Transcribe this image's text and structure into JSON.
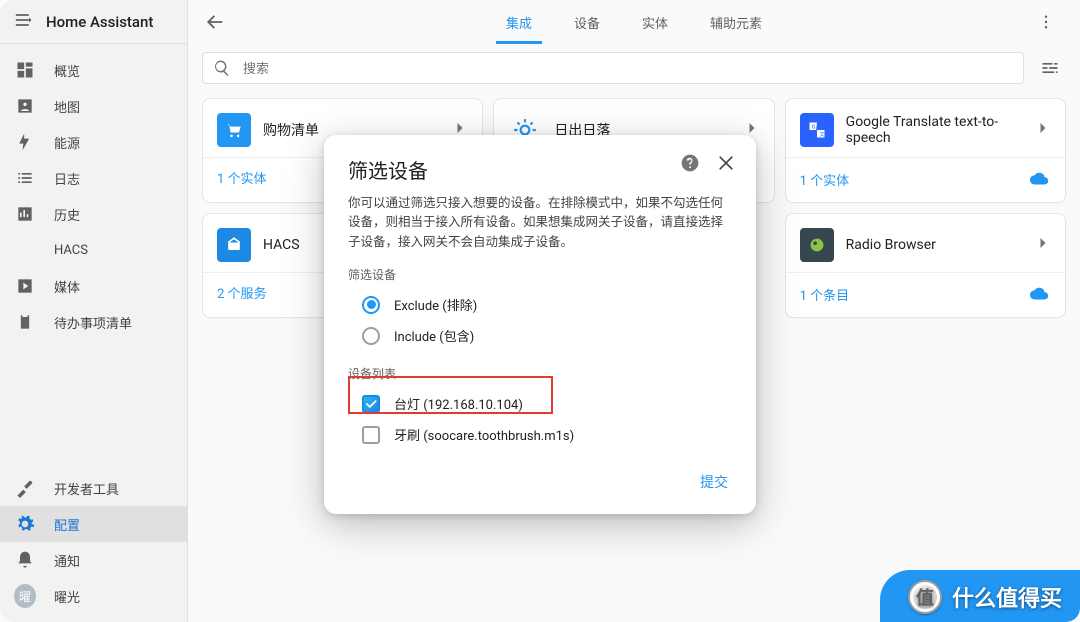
{
  "app": {
    "title": "Home Assistant"
  },
  "sidebar": {
    "items": [
      {
        "label": "概览"
      },
      {
        "label": "地图"
      },
      {
        "label": "能源"
      },
      {
        "label": "日志"
      },
      {
        "label": "历史"
      },
      {
        "label": "HACS"
      },
      {
        "label": "媒体"
      },
      {
        "label": "待办事项清单"
      }
    ],
    "bottom": {
      "dev": "开发者工具",
      "config": "配置",
      "notify": "通知",
      "user": {
        "initial": "曜",
        "name": "曜光"
      }
    }
  },
  "tabs": {
    "t0": "集成",
    "t1": "设备",
    "t2": "实体",
    "t3": "辅助元素"
  },
  "search": {
    "placeholder": "搜索"
  },
  "cards": [
    {
      "title": "购物清单",
      "footer": "1 个实体",
      "cloud": false,
      "icon_bg": "#2196f3"
    },
    {
      "title": "日出日落",
      "footer": "",
      "cloud": false,
      "icon_bg": "#2196f3"
    },
    {
      "title": "Google Translate text-to-speech",
      "footer": "1 个实体",
      "cloud": true,
      "icon_bg": "#2962ff"
    },
    {
      "title": "HACS",
      "footer": "2 个服务",
      "cloud": false,
      "icon_bg": "#1e88e5"
    },
    {
      "title": "",
      "footer": "",
      "cloud": false,
      "icon_bg": ""
    },
    {
      "title": "Radio Browser",
      "footer": "1 个条目",
      "cloud": true,
      "icon_bg": "#37474f"
    }
  ],
  "dialog": {
    "title": "筛选设备",
    "description": "你可以通过筛选只接入想要的设备。在排除模式中，如果不勾选任何设备，则相当于接入所有设备。如果想集成网关子设备，请直接选择子设备，接入网关不会自动集成子设备。",
    "section_filter": "筛选设备",
    "options": {
      "exclude": "Exclude (排除)",
      "include": "Include (包含)"
    },
    "section_list": "设备列表",
    "devices": [
      {
        "label": "台灯 (192.168.10.104)",
        "checked": true
      },
      {
        "label": "牙刷 (soocare.toothbrush.m1s)",
        "checked": false
      }
    ],
    "submit": "提交"
  },
  "watermark": {
    "badge": "值",
    "text": "什么值得买"
  }
}
